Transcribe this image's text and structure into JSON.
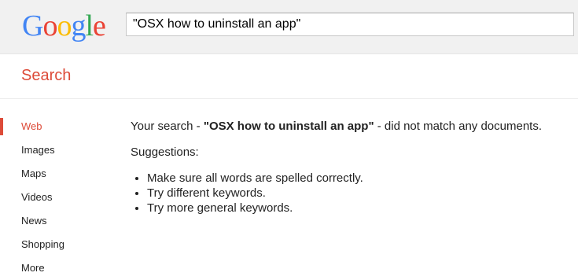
{
  "logo": {
    "letters": [
      {
        "ch": "G",
        "color": "#4285f4"
      },
      {
        "ch": "o",
        "color": "#ea4335"
      },
      {
        "ch": "o",
        "color": "#fbbc05"
      },
      {
        "ch": "g",
        "color": "#4285f4"
      },
      {
        "ch": "l",
        "color": "#34a853"
      },
      {
        "ch": "e",
        "color": "#ea4335"
      }
    ]
  },
  "search": {
    "value": "\"OSX how to uninstall an app\""
  },
  "subbar": {
    "title": "Search"
  },
  "nav": {
    "items": [
      {
        "label": "Web"
      },
      {
        "label": "Images"
      },
      {
        "label": "Maps"
      },
      {
        "label": "Videos"
      },
      {
        "label": "News"
      },
      {
        "label": "Shopping"
      },
      {
        "label": "More"
      }
    ]
  },
  "results": {
    "prefix": "Your search - ",
    "query": "\"OSX how to uninstall an app\"",
    "suffix": " - did not match any documents.",
    "suggestions_title": "Suggestions:",
    "suggestions": [
      "Make sure all words are spelled correctly.",
      "Try different keywords.",
      "Try more general keywords."
    ]
  },
  "colors": {
    "accent": "#dd4b39",
    "header_bg": "#f1f1f1"
  }
}
